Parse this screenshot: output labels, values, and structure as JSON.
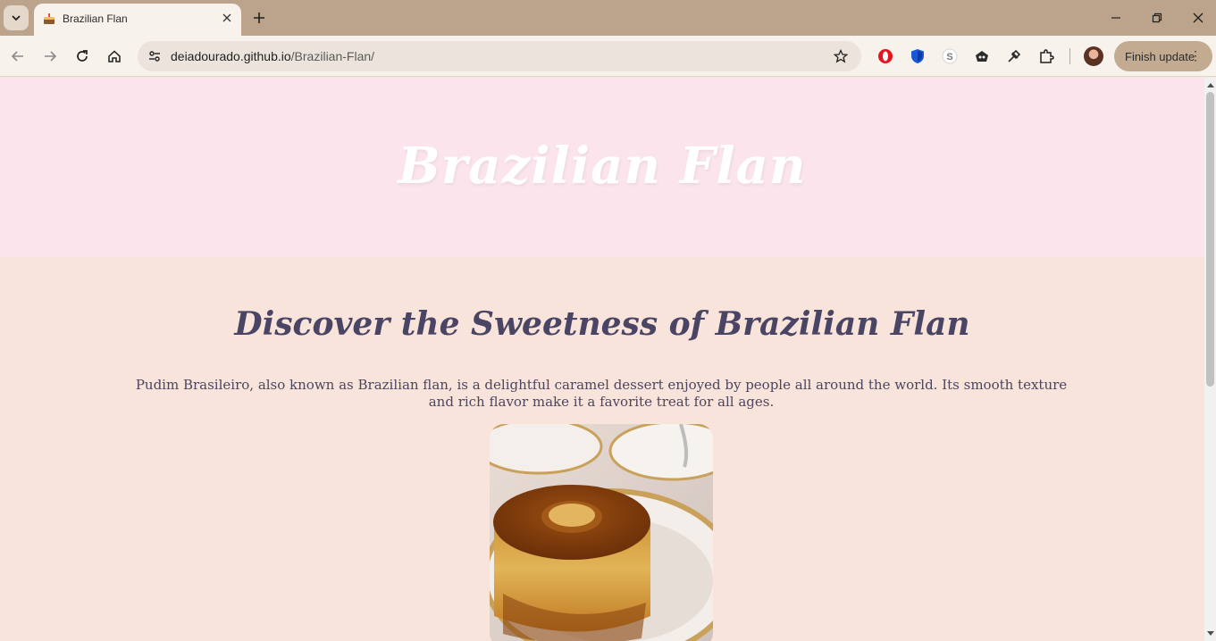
{
  "browser": {
    "tab": {
      "title": "Brazilian Flan",
      "favicon": "cake-icon"
    },
    "address": {
      "host": "deiadourado.github.io",
      "path": "/Brazilian-Flan/"
    },
    "update_button": "Finish update",
    "extensions": [
      "opera-icon",
      "shield-icon",
      "s-extension-icon",
      "game-icon",
      "brush-icon",
      "puzzle-icon"
    ]
  },
  "page": {
    "hero_title": "Brazilian Flan",
    "section_title": "Discover the Sweetness of Brazilian Flan",
    "intro": "Pudim Brasileiro, also known as Brazilian flan, is a delightful caramel dessert enjoyed by people all around the world. Its smooth texture and rich flavor make it a favorite treat for all ages."
  },
  "colors": {
    "hero_bg": "#fbe4ec",
    "content_bg": "#f8e4da",
    "title_color": "#4a4564",
    "chrome_bg": "#bba48b"
  }
}
